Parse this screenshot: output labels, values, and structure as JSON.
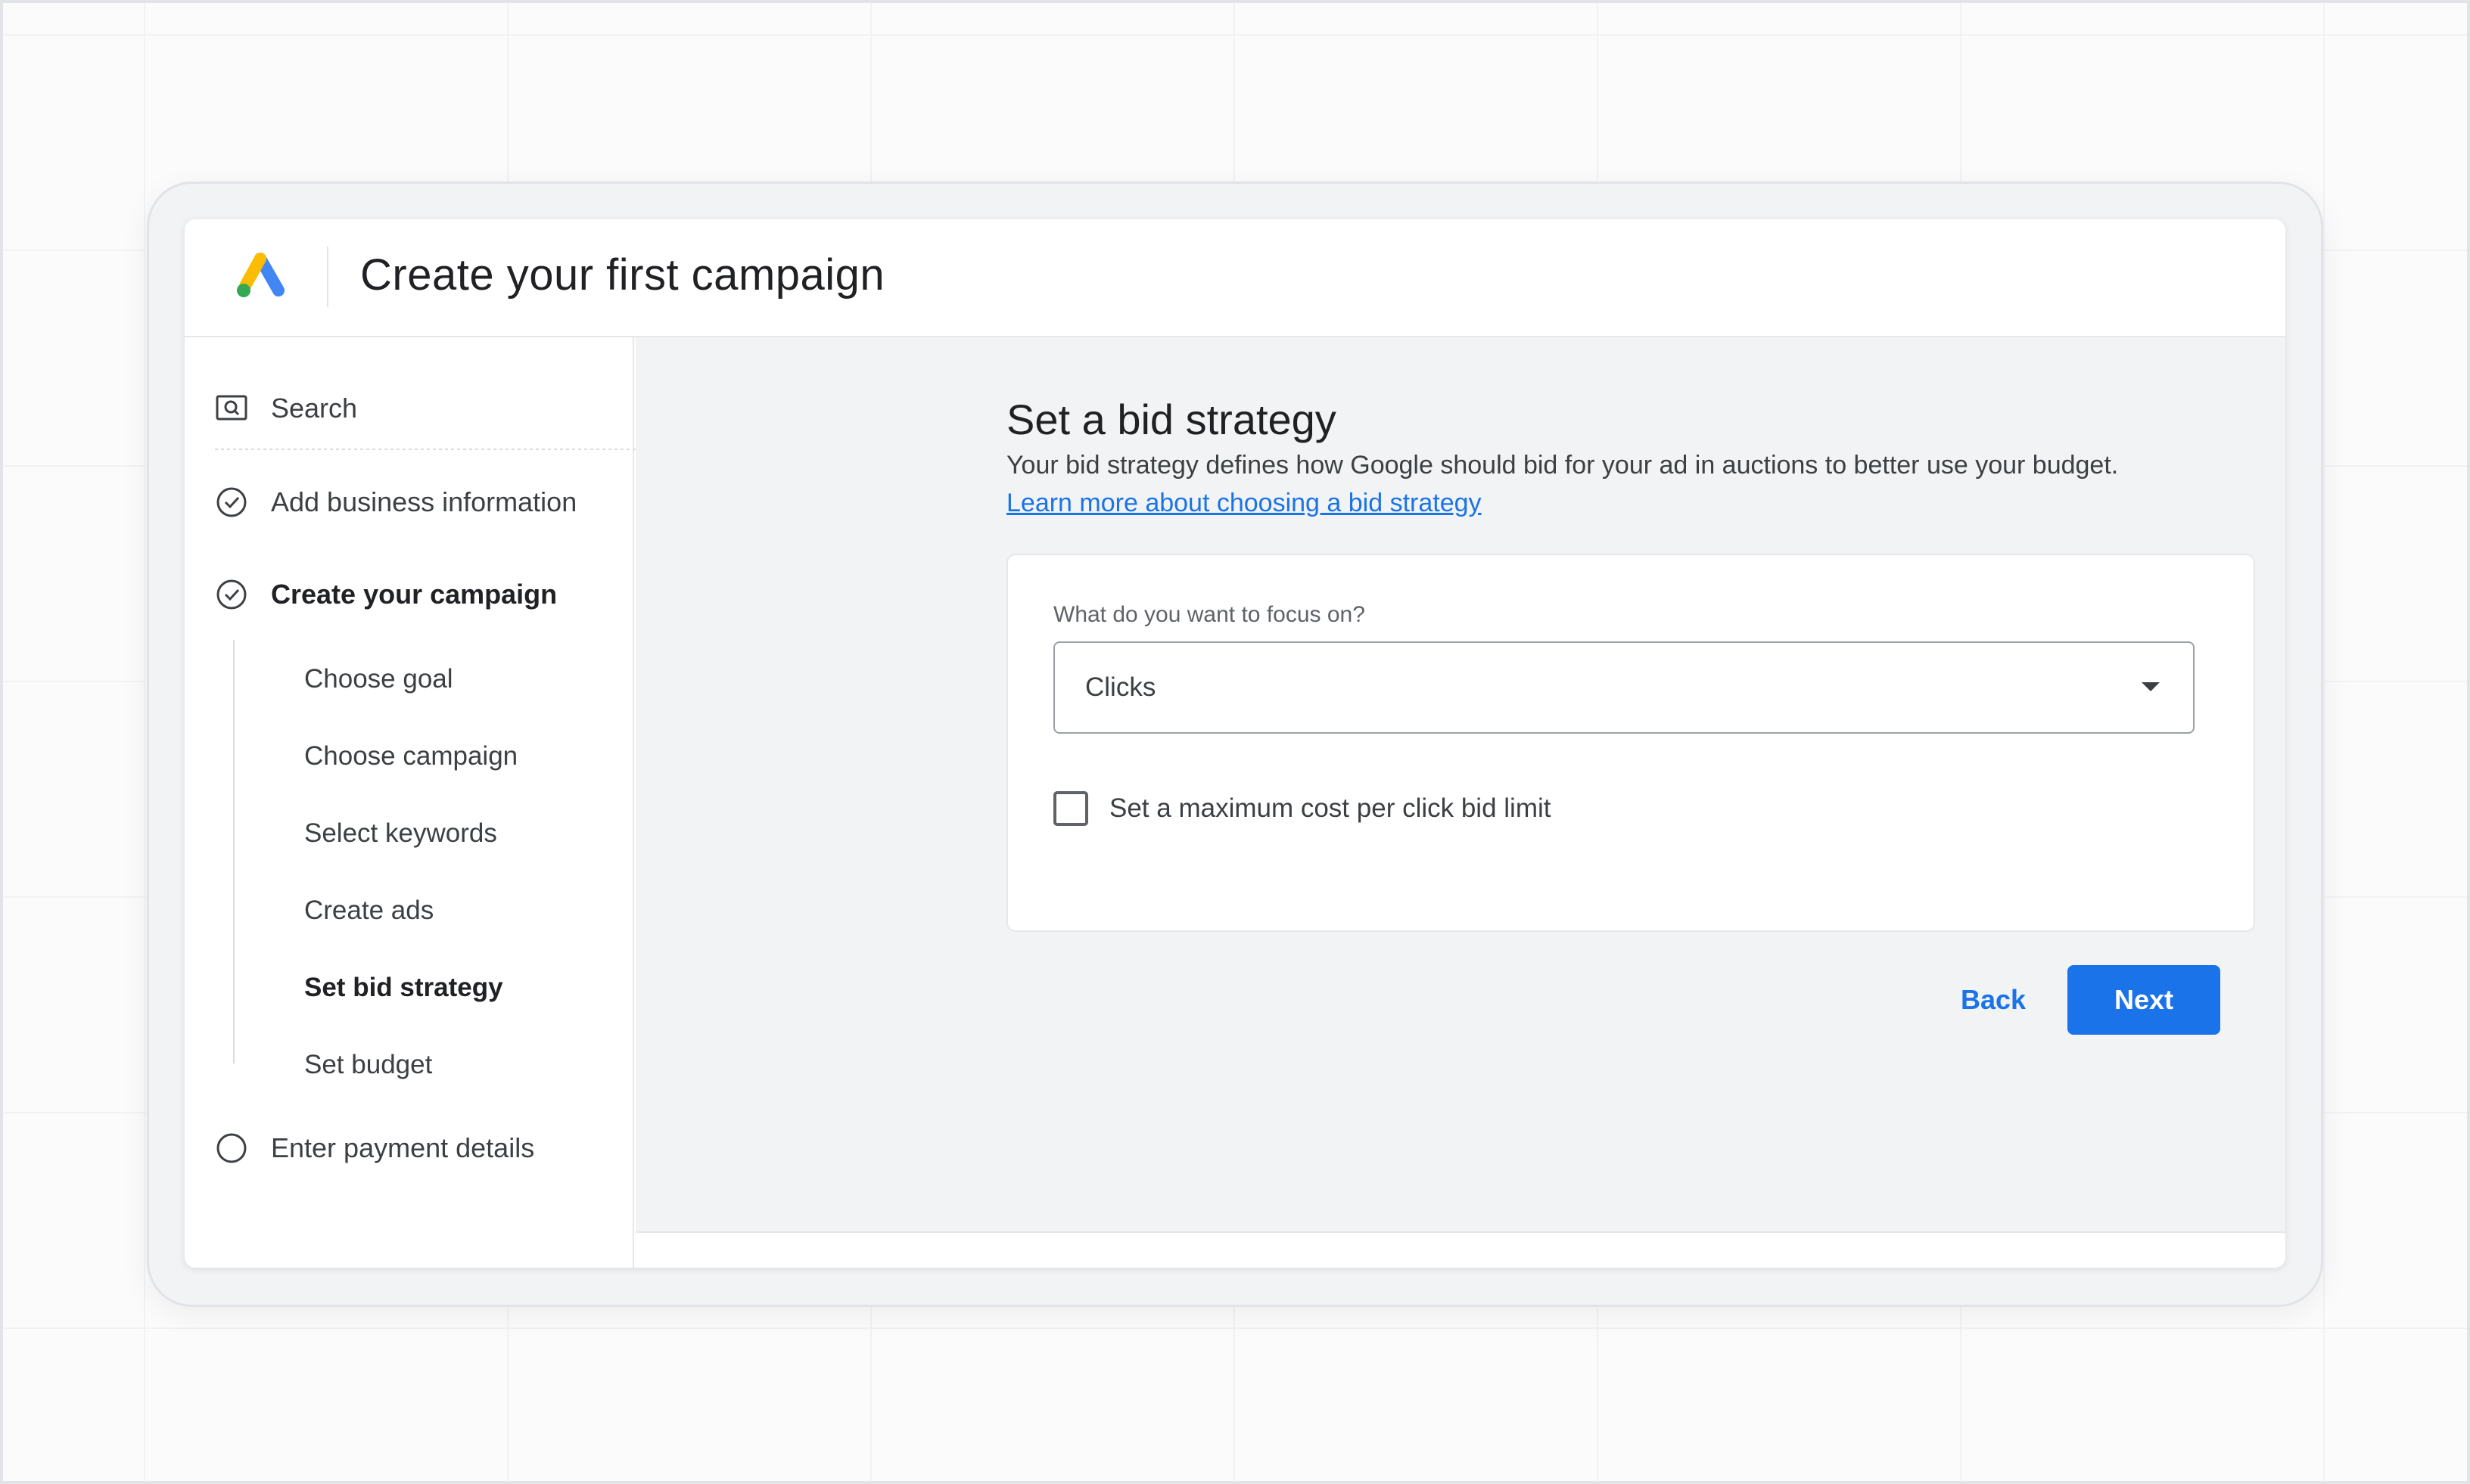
{
  "header": {
    "title": "Create your first campaign",
    "logo_icon": "google-ads-logo"
  },
  "sidebar": {
    "items": [
      {
        "label": "Search",
        "icon": "search-box-icon",
        "state": "info"
      },
      {
        "label": "Add business information",
        "icon": "check-circle-icon",
        "state": "done"
      },
      {
        "label": "Create your campaign",
        "icon": "check-circle-icon",
        "state": "current"
      },
      {
        "label": "Enter payment details",
        "icon": "empty-circle-icon",
        "state": "pending"
      }
    ],
    "subitems": [
      {
        "label": "Choose goal",
        "active": false
      },
      {
        "label": "Choose campaign",
        "active": false
      },
      {
        "label": "Select keywords",
        "active": false
      },
      {
        "label": "Create ads",
        "active": false
      },
      {
        "label": "Set bid strategy",
        "active": true
      },
      {
        "label": "Set budget",
        "active": false
      }
    ]
  },
  "main": {
    "title": "Set a bid strategy",
    "description": "Your bid strategy defines how Google should bid for your ad in auctions to better use your budget.",
    "link": "Learn more about choosing a bid strategy",
    "focus_label": "What do you want to focus on?",
    "focus_value": "Clicks",
    "checkbox_label": "Set a maximum cost per click bid limit",
    "checkbox_checked": false,
    "back_label": "Back",
    "next_label": "Next"
  },
  "colors": {
    "accent": "#1a73e8",
    "logo_blue": "#4285f4",
    "logo_yellow": "#fbbc04",
    "logo_green": "#34a853"
  }
}
